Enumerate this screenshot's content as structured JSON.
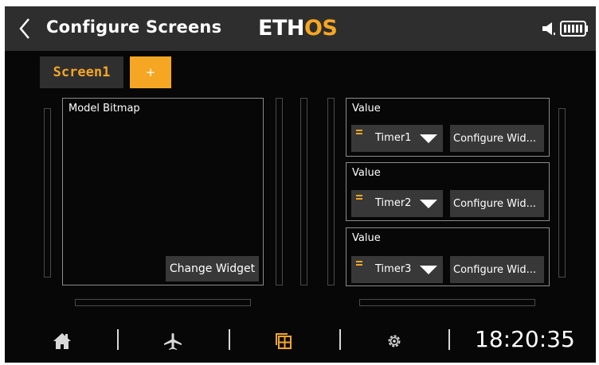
{
  "header": {
    "title": "Configure Screens",
    "logo": {
      "left": "ETH",
      "right": "OS",
      "left_color": "#ffffff",
      "right_color": "#f5a623"
    }
  },
  "tabs": [
    {
      "label": "Screen1",
      "active": true
    },
    {
      "label": "+"
    }
  ],
  "widgets": {
    "main": {
      "title": "Model Bitmap",
      "button": "Change Widget"
    },
    "values": [
      {
        "title": "Value",
        "source": "Timer1",
        "button": "Configure Wid..."
      },
      {
        "title": "Value",
        "source": "Timer2",
        "button": "Configure Wid..."
      },
      {
        "title": "Value",
        "source": "Timer3",
        "button": "Configure Wid..."
      }
    ]
  },
  "footer": {
    "icons": [
      "home-icon",
      "airplane-icon",
      "screens-icon",
      "settings-gear-icon"
    ],
    "clock": "18:20:35"
  },
  "colors": {
    "accent": "#f5a623",
    "header": "#2e2e2e",
    "background": "#070707",
    "button": "#383838"
  }
}
